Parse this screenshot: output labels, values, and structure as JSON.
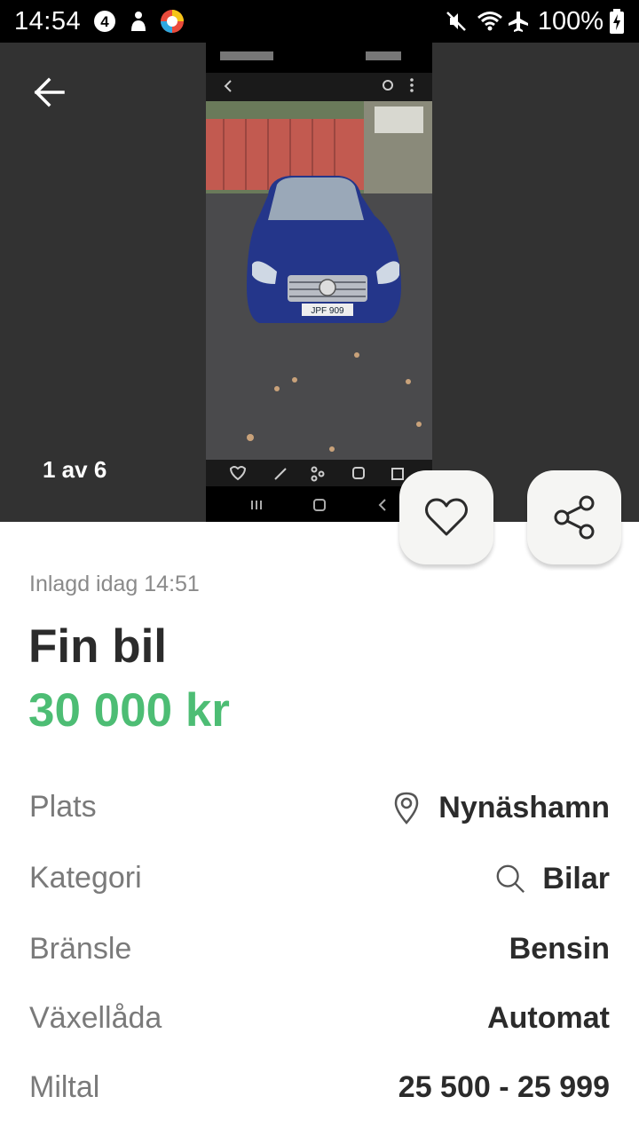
{
  "status_bar": {
    "time": "14:54",
    "battery": "100%",
    "icons": [
      "notification-4-icon",
      "app-icon",
      "app-color-icon",
      "mute-icon",
      "wifi-icon",
      "airplane-icon",
      "battery-charging-icon"
    ]
  },
  "gallery": {
    "counter": "1 av 6",
    "photo_description_icon": "car-photo",
    "back_icon": "arrow-left-icon"
  },
  "actions": {
    "favorite_icon": "heart-icon",
    "share_icon": "share-icon"
  },
  "listing": {
    "posted": "Inlagd idag 14:51",
    "title": "Fin bil",
    "price": "30 000 kr",
    "price_color": "#4dbd74"
  },
  "details": [
    {
      "label": "Plats",
      "value": "Nynäshamn",
      "icon": "location-pin-icon"
    },
    {
      "label": "Kategori",
      "value": "Bilar",
      "icon": "search-icon"
    },
    {
      "label": "Bränsle",
      "value": "Bensin"
    },
    {
      "label": "Växellåda",
      "value": "Automat"
    },
    {
      "label": "Miltal",
      "value": "25 500 - 25 999"
    }
  ]
}
